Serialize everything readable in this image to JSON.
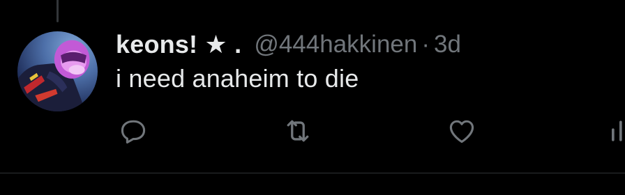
{
  "tweet": {
    "display_name": "keons! ★ .",
    "handle": "@444hakkinen",
    "separator": "·",
    "timestamp": "3d",
    "text": "i need anaheim to die"
  },
  "actions": {
    "reply_icon": "reply-icon",
    "retweet_icon": "retweet-icon",
    "like_icon": "heart-icon",
    "views_icon": "views-icon"
  },
  "colors": {
    "background": "#000000",
    "primary_text": "#e7e9ea",
    "secondary_text": "#71767b",
    "icon": "#71767b",
    "divider": "#2f3336"
  }
}
